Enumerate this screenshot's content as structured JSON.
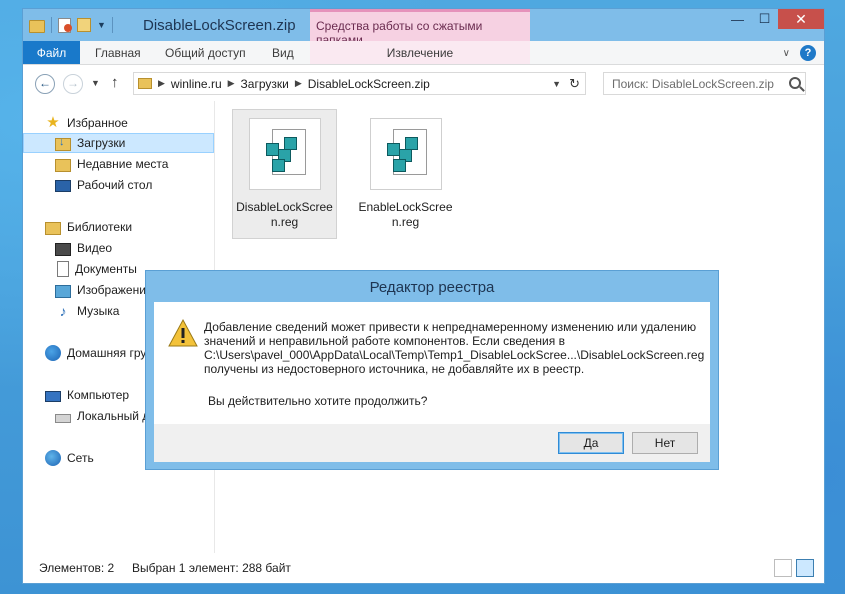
{
  "window": {
    "title": "DisableLockScreen.zip",
    "context_group": "Средства работы со сжатыми папками",
    "controls": {
      "minimize": "—",
      "maximize": "☐",
      "close": "✕"
    }
  },
  "ribbon": {
    "tabs": [
      "Файл",
      "Главная",
      "Общий доступ",
      "Вид"
    ],
    "context_tab": "Извлечение",
    "help": "?"
  },
  "address": {
    "crumbs": [
      "winline.ru",
      "Загрузки",
      "DisableLockScreen.zip"
    ],
    "search_placeholder": "Поиск: DisableLockScreen.zip"
  },
  "nav": {
    "favorites": "Избранное",
    "downloads": "Загрузки",
    "recent": "Недавние места",
    "desktop": "Рабочий стол",
    "libraries": "Библиотеки",
    "video": "Видео",
    "documents": "Документы",
    "images": "Изображения",
    "music": "Музыка",
    "homegroup": "Домашняя группа",
    "computer": "Компьютер",
    "localdisk": "Локальный диск",
    "network": "Сеть"
  },
  "files": [
    {
      "name_line1": "DisableLockScree",
      "name_line2": "n.reg"
    },
    {
      "name_line1": "EnableLockScree",
      "name_line2": "n.reg"
    }
  ],
  "status": {
    "count": "Элементов: 2",
    "selection": "Выбран 1 элемент: 288 байт"
  },
  "dialog": {
    "title": "Редактор реестра",
    "line1": "Добавление сведений может привести к непреднамеренному изменению или удалению",
    "line2": "значений и неправильной работе компонентов. Если сведения в",
    "line3": "C:\\Users\\pavel_000\\AppData\\Local\\Temp\\Temp1_DisableLockScree...\\DisableLockScreen.reg",
    "line4": "получены из недостоверного источника, не добавляйте их в реестр.",
    "question": "Вы действительно хотите продолжить?",
    "yes": "Да",
    "no": "Нет"
  }
}
